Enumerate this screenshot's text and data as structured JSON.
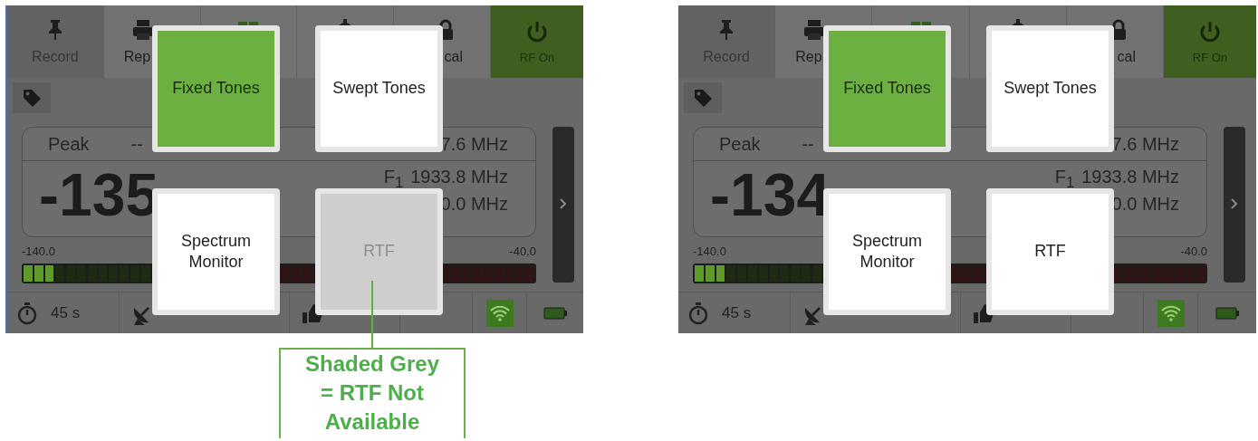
{
  "screens": [
    {
      "tabs": [
        {
          "label": "Record",
          "disabled": true
        },
        {
          "label": "Rep",
          "disabled": false
        },
        {
          "disabled": false
        },
        {
          "disabled": false
        },
        {
          "label": "cal",
          "disabled": false
        }
      ],
      "rf_button": {
        "label": "RF On",
        "on": true
      },
      "panel": {
        "mode": "Peak",
        "mode_value": "--",
        "freq_top": "7.6 MHz",
        "reading": "-135",
        "f_label": "F$_{1}$",
        "f1": "1933.8 MHz",
        "f2": "0.0 MHz"
      },
      "meter": {
        "min": "-140.0",
        "max": "-40.0",
        "level": 0.0625
      },
      "status": {
        "timer": "45 s",
        "wifi_on": true
      },
      "menu": [
        {
          "label": "Fixed Tones",
          "selected": true,
          "disabled": false
        },
        {
          "label": "Swept Tones",
          "selected": false,
          "disabled": false
        },
        {
          "label": "Spectrum Monitor",
          "selected": false,
          "disabled": false
        },
        {
          "label": "RTF",
          "selected": false,
          "disabled": true
        }
      ],
      "callout": {
        "text": "Shaded Grey = RTF Not Available"
      }
    },
    {
      "tabs": [
        {
          "label": "Record",
          "disabled": true
        },
        {
          "label": "Rep",
          "disabled": false
        },
        {
          "disabled": false
        },
        {
          "disabled": false
        },
        {
          "label": "cal",
          "disabled": false
        }
      ],
      "rf_button": {
        "label": "RF On",
        "on": true
      },
      "panel": {
        "mode": "Peak",
        "mode_value": "--",
        "freq_top": "7.6 MHz",
        "reading": "-134",
        "f_label": "F$_{1}$",
        "f1": "1933.8 MHz",
        "f2": "0.0 MHz"
      },
      "meter": {
        "min": "-140.0",
        "max": "-40.0",
        "level": 0.0625
      },
      "status": {
        "timer": "45 s",
        "wifi_on": true
      },
      "menu": [
        {
          "label": "Fixed Tones",
          "selected": true,
          "disabled": false
        },
        {
          "label": "Swept Tones",
          "selected": false,
          "disabled": false
        },
        {
          "label": "Spectrum Monitor",
          "selected": false,
          "disabled": false
        },
        {
          "label": "RTF",
          "selected": false,
          "disabled": false
        }
      ]
    }
  ]
}
